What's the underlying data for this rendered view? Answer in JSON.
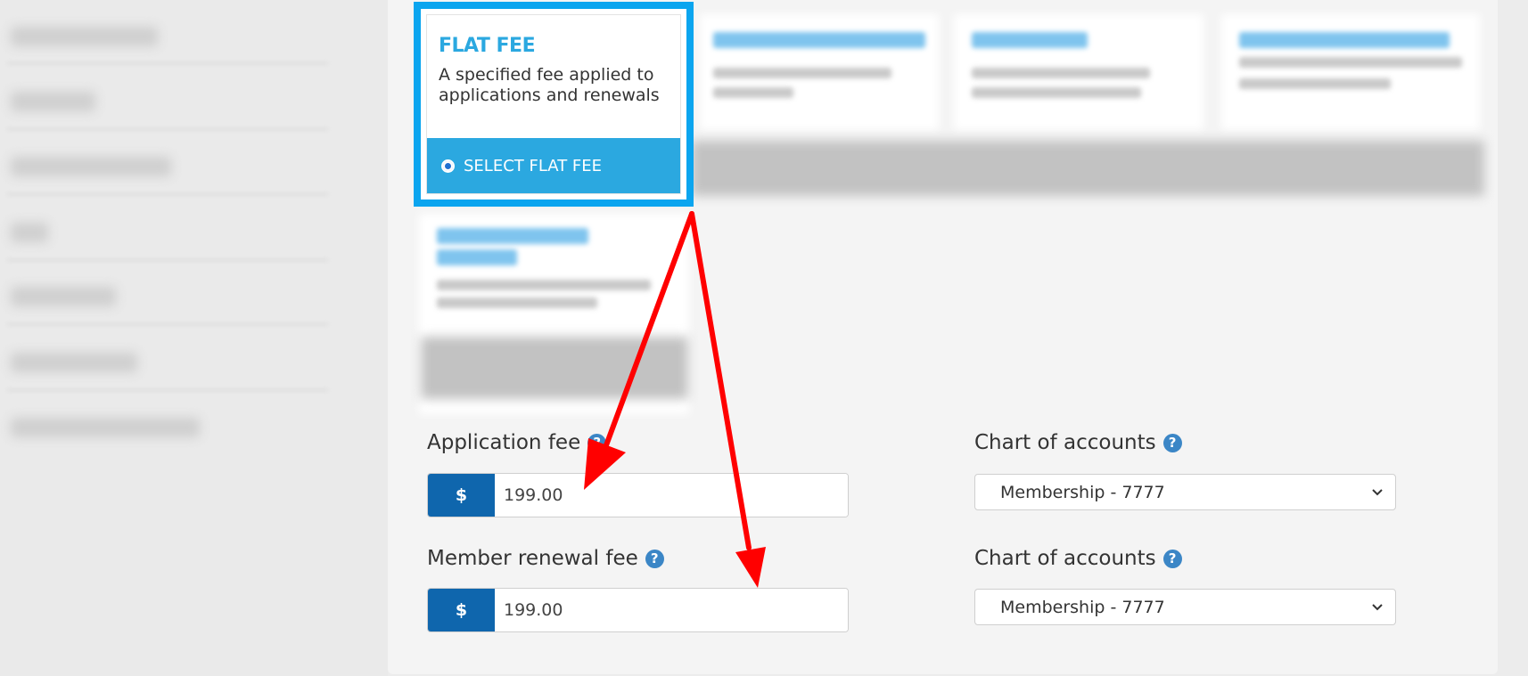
{
  "flat_fee_card": {
    "title": "FLAT FEE",
    "description": "A specified fee applied to applications and renewals",
    "select_label": "SELECT FLAT FEE"
  },
  "application_fee": {
    "label": "Application fee",
    "currency": "$",
    "value": "199.00",
    "help_icon": "question-circle-icon"
  },
  "member_renewal_fee": {
    "label": "Member renewal fee",
    "currency": "$",
    "value": "199.00",
    "help_icon": "question-circle-icon"
  },
  "application_chart_of_accounts": {
    "label": "Chart of accounts",
    "selected": "Membership - 7777"
  },
  "renewal_chart_of_accounts": {
    "label": "Chart of accounts",
    "selected": "Membership - 7777"
  },
  "help_glyph": "?",
  "colors": {
    "highlight_border": "#0ba5ef",
    "card_accent": "#2ba8e0",
    "addon_blue": "#0f66ad",
    "annotation_arrow": "#ff0000"
  }
}
